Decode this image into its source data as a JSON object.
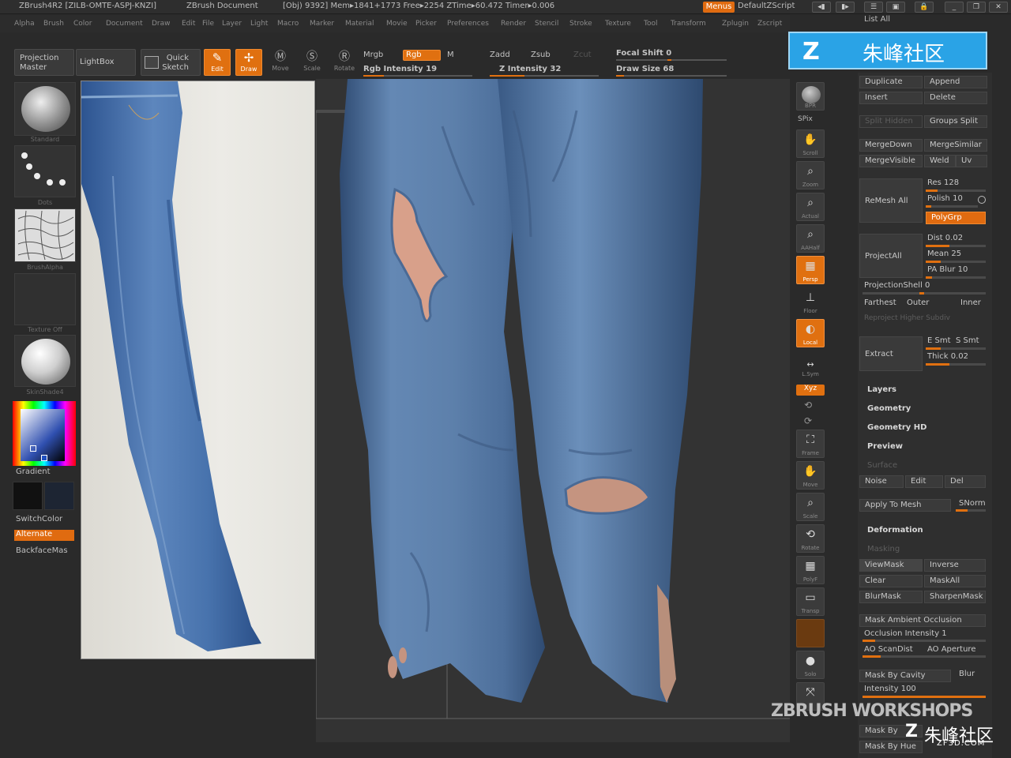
{
  "titlebar": {
    "app": "ZBrush4R2 [ZILB-OMTE-ASPJ-KNZI]",
    "doc": "ZBrush Document",
    "stats": "[Obj) 9392] Mem▸1841+1773 Free▸2254 ZTime▸60.472 Timer▸0.006",
    "menus": "Menus",
    "script": "DefaultZScript",
    "list_all": "List All"
  },
  "menubar": [
    "Alpha",
    "Brush",
    "Color",
    "Document",
    "Draw",
    "Edit",
    "File",
    "Layer",
    "Light",
    "Macro",
    "Marker",
    "Material",
    "Movie",
    "Picker",
    "Preferences",
    "Render",
    "Stencil",
    "Stroke",
    "Texture",
    "Tool",
    "Transform",
    "Zplugin",
    "Zscript"
  ],
  "toolbar": {
    "projection_master": [
      "Projection",
      "Master"
    ],
    "lightbox": "LightBox",
    "quick_sketch": [
      "Quick",
      "Sketch"
    ],
    "edit": "Edit",
    "draw": "Draw",
    "move": "Move",
    "scale": "Scale",
    "rotate": "Rotate",
    "mrgb": "Mrgb",
    "rgb": "Rgb",
    "m": "M",
    "rgb_intensity": "Rgb Intensity 19",
    "zadd": "Zadd",
    "zsub": "Zsub",
    "zcut": "Zcut",
    "z_intensity": "Z Intensity 32",
    "focal_shift": "Focal Shift 0",
    "draw_size": "Draw Size 68",
    "rgb_intensity_value": 19,
    "z_intensity_value": 32,
    "draw_size_value": 68
  },
  "left": {
    "standard": "Standard",
    "dots": "Dots",
    "brushalpha": "BrushAlpha",
    "texture_off": "Texture Off",
    "material": "SkinShade4",
    "gradient": "Gradient",
    "switchcolor": "SwitchColor",
    "alternate": "Alternate",
    "backfacemask": "BackfaceMas"
  },
  "righttools": [
    "BPR",
    "SPix",
    "Scroll",
    "Zoom",
    "Actual",
    "AAHalf",
    "Persp",
    "Floor",
    "Local",
    "L.Sym",
    "Xyz",
    "",
    "",
    "Frame",
    "Move",
    "Scale",
    "Rotate",
    "PolyF",
    "Transp",
    "",
    "Solo",
    ""
  ],
  "panel": {
    "duplicate": "Duplicate",
    "append": "Append",
    "insert": "Insert",
    "delete": "Delete",
    "split_hidden": "Split Hidden",
    "groups_split": "Groups Split",
    "mergedown": "MergeDown",
    "mergesimilar": "MergeSimilar",
    "mergevisible": "MergeVisible",
    "weld": "Weld",
    "uv": "Uv",
    "remesh_all": "ReMesh All",
    "res": "Res 128",
    "polish": "Polish 10",
    "polygrp": "PolyGrp",
    "projectall": "ProjectAll",
    "dist": "Dist 0.02",
    "mean": "Mean 25",
    "pa_blur": "PA Blur 10",
    "projectionshell": "ProjectionShell 0",
    "farthest": "Farthest",
    "outer": "Outer",
    "inner": "Inner",
    "reproject": "Reproject Higher Subdiv",
    "extract": "Extract",
    "e_smt": "E Smt",
    "s_smt": "S Smt",
    "thick": "Thick 0.02",
    "layers": "Layers",
    "geometry": "Geometry",
    "geometry_hd": "Geometry HD",
    "preview": "Preview",
    "surface": "Surface",
    "noise": "Noise",
    "edit": "Edit",
    "del": "Del",
    "apply_to_mesh": "Apply To Mesh",
    "snorm": "SNorm",
    "deformation": "Deformation",
    "masking": "Masking",
    "viewmask": "ViewMask",
    "inverse": "Inverse",
    "clear": "Clear",
    "maskall": "MaskAll",
    "blurmask": "BlurMask",
    "sharpenmask": "SharpenMask",
    "mask_ao": "Mask Ambient Occlusion",
    "occlusion_intensity": "Occlusion Intensity 1",
    "ao_scandist": "AO ScanDist",
    "ao_aperture": "AO Aperture",
    "mask_by_cavity": "Mask By Cavity",
    "blur": "Blur",
    "intensity": "Intensity 100",
    "mask_by_1": "Mask By",
    "mask_by_hue": "Mask By Hue"
  },
  "watermarks": {
    "top": "朱峰社区",
    "workshops": "ZBRUSH WORKSHOPS",
    "bottom": "朱峰社区",
    "url": "ZF3D.COM"
  },
  "colors": {
    "accent": "#e07010",
    "background": "#2a2a2a",
    "mesh": "#5d7fa6",
    "skin": "#d8a08a",
    "denim": "#3f6aa3"
  }
}
